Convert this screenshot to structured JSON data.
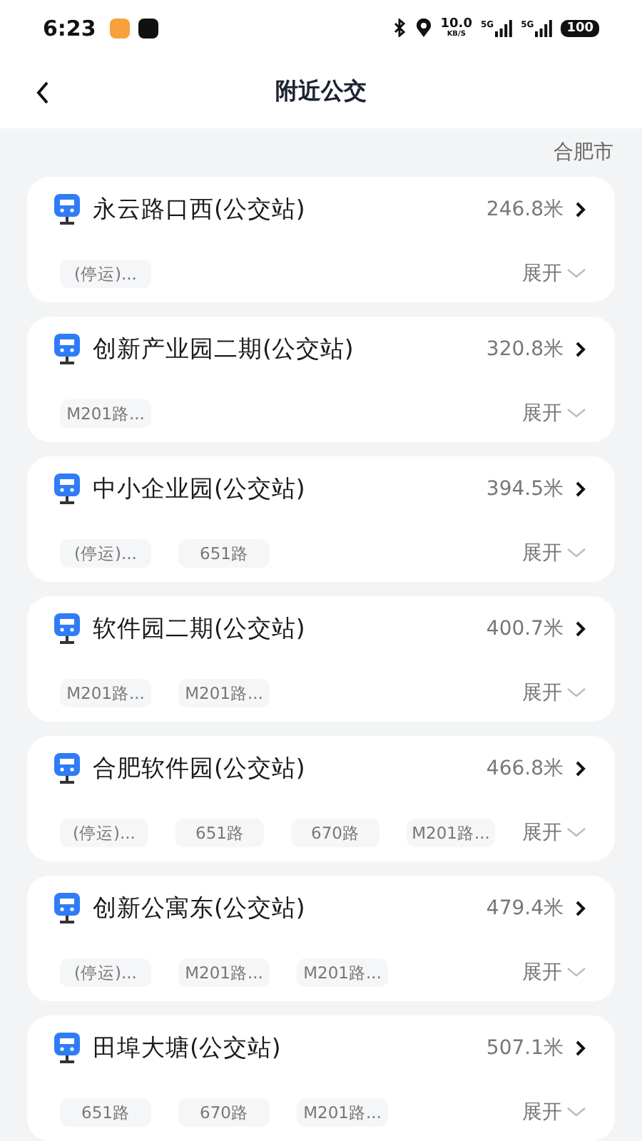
{
  "status_bar": {
    "time": "6:23",
    "speed": "10.0",
    "speed_unit": "KB/S",
    "network_1": "5G",
    "network_2": "5G",
    "battery": "100"
  },
  "header": {
    "title": "附近公交"
  },
  "city": "合肥市",
  "stations": [
    {
      "name": "永云路口西(公交站)",
      "distance": "246.8米",
      "lines": [
        "(停运)..."
      ],
      "expand": "展开"
    },
    {
      "name": "创新产业园二期(公交站)",
      "distance": "320.8米",
      "lines": [
        "M201路..."
      ],
      "expand": "展开"
    },
    {
      "name": "中小企业园(公交站)",
      "distance": "394.5米",
      "lines": [
        "(停运)...",
        "651路"
      ],
      "expand": "展开"
    },
    {
      "name": "软件园二期(公交站)",
      "distance": "400.7米",
      "lines": [
        "M201路...",
        "M201路..."
      ],
      "expand": "展开"
    },
    {
      "name": "合肥软件园(公交站)",
      "distance": "466.8米",
      "lines": [
        "(停运)...",
        "651路",
        "670路",
        "M201路..."
      ],
      "expand": "展开"
    },
    {
      "name": "创新公寓东(公交站)",
      "distance": "479.4米",
      "lines": [
        "(停运)...",
        "M201路...",
        "M201路..."
      ],
      "expand": "展开"
    },
    {
      "name": "田埠大塘(公交站)",
      "distance": "507.1米",
      "lines": [
        "651路",
        "670路",
        "M201路..."
      ],
      "expand": "展开"
    }
  ]
}
